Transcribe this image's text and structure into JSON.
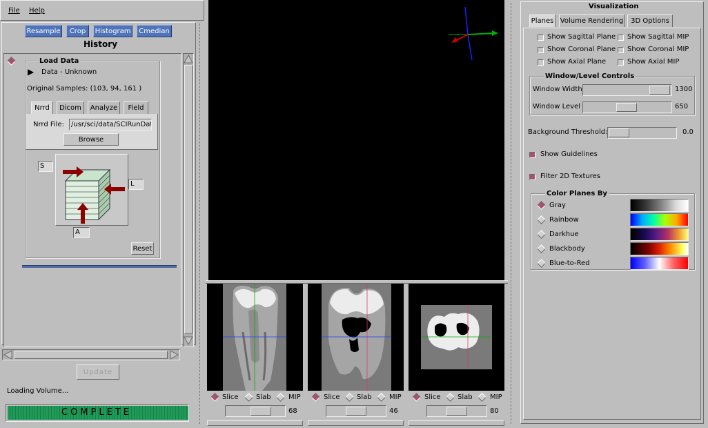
{
  "menu": {
    "file": "File",
    "help": "Help"
  },
  "history": {
    "buttons": [
      "Resample",
      "Crop",
      "Histogram",
      "Cmedian"
    ],
    "title": "History",
    "load_data": {
      "title": "Load Data",
      "data_label": "Data - Unknown",
      "original_samples": "Original Samples: (103, 94, 161 )",
      "tabs": [
        "Nrrd",
        "Dicom",
        "Analyze",
        "Field"
      ],
      "nrrd_file_label": "Nrrd File:",
      "nrrd_file_value": "/usr/sci/data/SCIRunData",
      "browse": "Browse",
      "orient_labels": {
        "s": "S",
        "l": "L",
        "a": "A"
      },
      "reset": "Reset"
    },
    "update": "Update",
    "status_text": "Loading Volume...",
    "progress_text": "COMPLETE",
    "progress_fraction": 1.0
  },
  "views": [
    {
      "id": "sagittal",
      "options": [
        "Slice",
        "Slab",
        "MIP"
      ],
      "selected": "Slice",
      "slider_value": "68"
    },
    {
      "id": "coronal",
      "options": [
        "Slice",
        "Slab",
        "MIP"
      ],
      "selected": "Slice",
      "slider_value": "46"
    },
    {
      "id": "axial",
      "options": [
        "Slice",
        "Slab",
        "MIP"
      ],
      "selected": "Slice",
      "slider_value": "80"
    }
  ],
  "visualization": {
    "title": "Visualization",
    "tabs": [
      "Planes",
      "Volume Rendering",
      "3D Options"
    ],
    "plane_checks": [
      {
        "label": "Show Sagittal Plane",
        "checked": false
      },
      {
        "label": "Show Sagittal MIP",
        "checked": false
      },
      {
        "label": "Show Coronal Plane",
        "checked": false
      },
      {
        "label": "Show Coronal MIP",
        "checked": false
      },
      {
        "label": "Show Axial Plane",
        "checked": false
      },
      {
        "label": "Show Axial MIP",
        "checked": false
      }
    ],
    "window_level": {
      "title": "Window/Level Controls",
      "width_label": "Window Width",
      "width_value": "1300",
      "level_label": "Window Level",
      "level_value": "650"
    },
    "background_threshold": {
      "label": "Background Threshold:",
      "value": "0.0"
    },
    "show_guidelines": {
      "label": "Show Guidelines",
      "checked": true
    },
    "filter_2d": {
      "label": "Filter 2D Textures",
      "checked": true
    },
    "color_planes": {
      "title": "Color Planes By",
      "selected": "Gray",
      "options": [
        "Gray",
        "Rainbow",
        "Darkhue",
        "Blackbody",
        "Blue-to-Red"
      ]
    }
  },
  "colors": {
    "background": "#bebebe",
    "button_blue": "#4f74ba",
    "checked": "#a7526a",
    "progress_green": "#1f9b57",
    "axis_red": "#cc0000",
    "axis_green": "#00b000",
    "axis_blue": "#1f1fff"
  }
}
